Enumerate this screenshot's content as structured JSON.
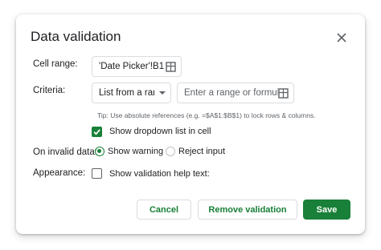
{
  "dialog": {
    "title": "Data validation",
    "close_icon": "close-icon"
  },
  "cell_range": {
    "label": "Cell range:",
    "value": "'Date Picker'!B1",
    "icon": "grid-select-icon"
  },
  "criteria": {
    "label": "Criteria:",
    "selected": "List from a range",
    "range_placeholder": "Enter a range or formula",
    "range_icon": "grid-select-icon",
    "tip": "Tip: Use absolute references (e.g. =$A$1:$B$1) to lock rows & columns.",
    "show_dropdown_label": "Show dropdown list in cell",
    "show_dropdown_checked": true
  },
  "invalid_data": {
    "label": "On invalid data:",
    "options": [
      "Show warning",
      "Reject input"
    ],
    "selected": "Show warning"
  },
  "appearance": {
    "label": "Appearance:",
    "help_text_label": "Show validation help text:",
    "help_text_checked": false
  },
  "buttons": {
    "cancel": "Cancel",
    "remove": "Remove validation",
    "save": "Save"
  },
  "colors": {
    "accent": "#188038",
    "border": "#dadce0",
    "secondary_text": "#5f6368"
  }
}
